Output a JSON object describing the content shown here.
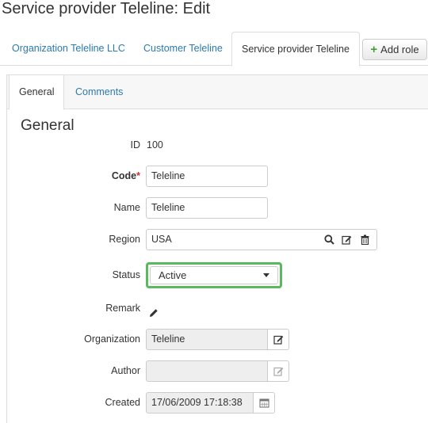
{
  "page": {
    "title": "Service provider Teleline: Edit"
  },
  "role_tabs": [
    {
      "label": "Organization Teleline LLC",
      "active": false
    },
    {
      "label": "Customer Teleline",
      "active": false
    },
    {
      "label": "Service provider Teleline",
      "active": true
    }
  ],
  "add_role_label": "Add role",
  "sub_tabs": [
    {
      "label": "General",
      "active": true
    },
    {
      "label": "Comments",
      "active": false
    }
  ],
  "section_title": "General",
  "form": {
    "id": {
      "label": "ID",
      "value": "100"
    },
    "code": {
      "label": "Code",
      "required_mark": "*",
      "value": "Teleline"
    },
    "name": {
      "label": "Name",
      "value": "Teleline"
    },
    "region": {
      "label": "Region",
      "value": "USA"
    },
    "status": {
      "label": "Status",
      "value": "Active"
    },
    "remark": {
      "label": "Remark"
    },
    "organization": {
      "label": "Organization",
      "value": "Teleline"
    },
    "author": {
      "label": "Author",
      "value": ""
    },
    "created": {
      "label": "Created",
      "value": "17/06/2009 17:18:38"
    }
  },
  "colors": {
    "link": "#2a7ab0",
    "focus_border": "#5cb85c",
    "required": "#c9302c",
    "add_icon": "#4a9a3a"
  },
  "icons": {
    "add": "plus-icon",
    "search": "search-icon",
    "edit": "edit-icon",
    "delete": "trash-icon",
    "remark": "pencil-icon",
    "calendar": "calendar-icon",
    "dropdown": "caret-down-icon"
  }
}
